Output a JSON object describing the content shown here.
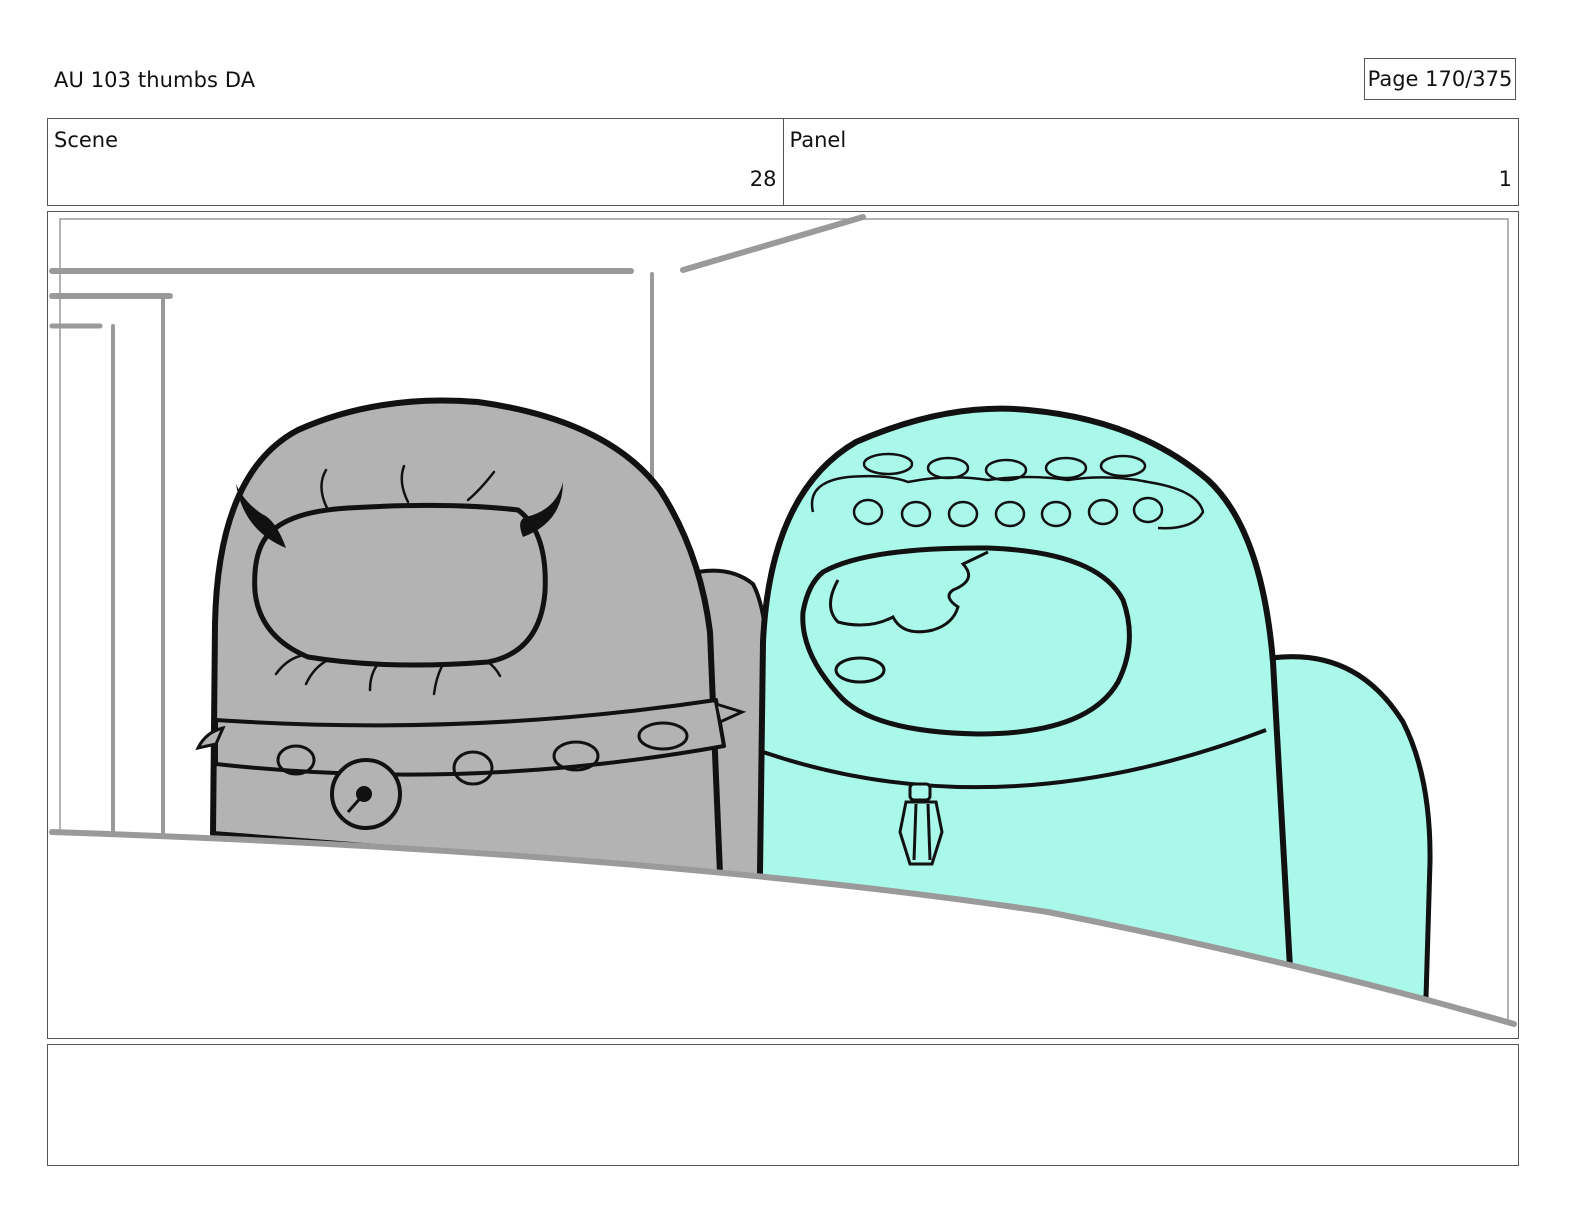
{
  "header": {
    "title": "AU 103 thumbs DA",
    "page_label": "Page 170/375"
  },
  "info": {
    "scene_label": "Scene",
    "scene_value": "28",
    "panel_label": "Panel",
    "panel_value": "1"
  },
  "drawing": {
    "gray_character_color": "#b3b3b3",
    "cyan_character_color": "#aaf8ea",
    "background_line_color": "#9a9a9a",
    "ink_color": "#111111"
  },
  "notes": {
    "text": ""
  }
}
